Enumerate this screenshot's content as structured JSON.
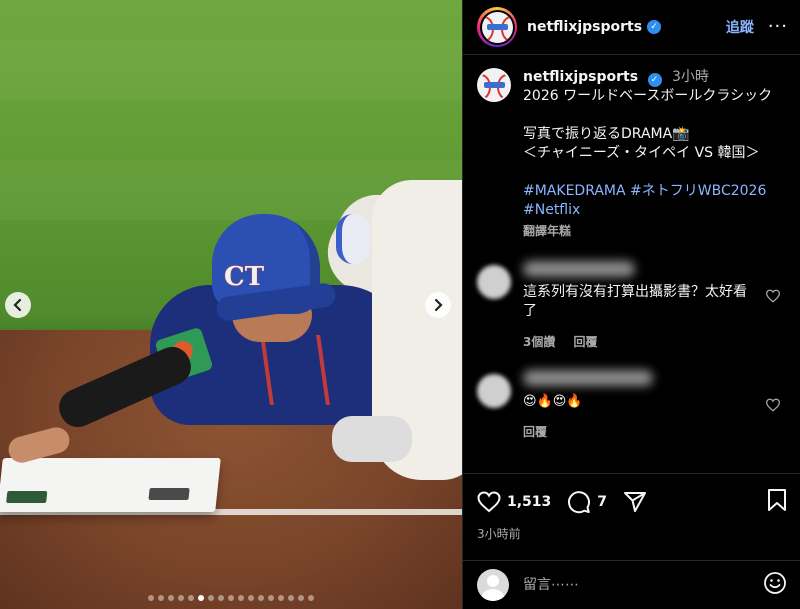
{
  "carousel": {
    "slide_count": 17,
    "active_index": 5
  },
  "header": {
    "username": "netflixjpsports",
    "follow_label": "追蹤",
    "more_label": "···"
  },
  "caption": {
    "username": "netflixjpsports",
    "time": "3小時",
    "line1": "2026 ワールドベースボールクラシック",
    "line2": "写真で振り返るDRAMA📸",
    "line3": "＜チャイニーズ・タイペイ VS 韓国＞",
    "hashtags_line1": "#MAKEDRAMA #ネトフリWBC2026",
    "hashtags_line2": "#Netflix",
    "translate_label": "翻譯年糕"
  },
  "comments": [
    {
      "text": "這系列有沒有打算出攝影書？太好看了",
      "reads": "3個讚",
      "reply_label": "回覆"
    },
    {
      "text": "😍🔥😍🔥",
      "reply_label": "回覆"
    }
  ],
  "actions": {
    "likes": "1,513",
    "comments": "7",
    "time_ago": "3小時前"
  },
  "comment_bar": {
    "placeholder": "留言⋯⋯"
  },
  "colors": {
    "accent_blue": "#8cb4ff",
    "verified_blue": "#2f8fef",
    "background": "#000000",
    "muted_text": "#a8a8a8"
  },
  "icons": {
    "like": "heart-icon",
    "comment": "comment-bubble-icon",
    "share": "paper-plane-icon",
    "save": "bookmark-icon",
    "emoji": "smiley-icon",
    "prev": "chevron-left-icon",
    "next": "chevron-right-icon",
    "verified": "verified-badge-icon",
    "more": "more-options-icon"
  }
}
